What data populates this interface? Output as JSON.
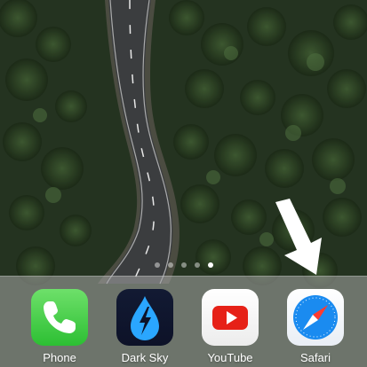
{
  "page_dots": {
    "count": 5,
    "active_index": 4
  },
  "dock": {
    "apps": [
      {
        "label": "Phone",
        "icon": "phone-icon"
      },
      {
        "label": "Dark Sky",
        "icon": "dark-sky-icon"
      },
      {
        "label": "YouTube",
        "icon": "youtube-icon"
      },
      {
        "label": "Safari",
        "icon": "safari-compass-icon"
      }
    ]
  },
  "colors": {
    "phone_green": "#2cbf33",
    "youtube_red": "#e62117",
    "safari_blue": "#1a8bf0",
    "darksky_blue": "#2aa6ff"
  }
}
